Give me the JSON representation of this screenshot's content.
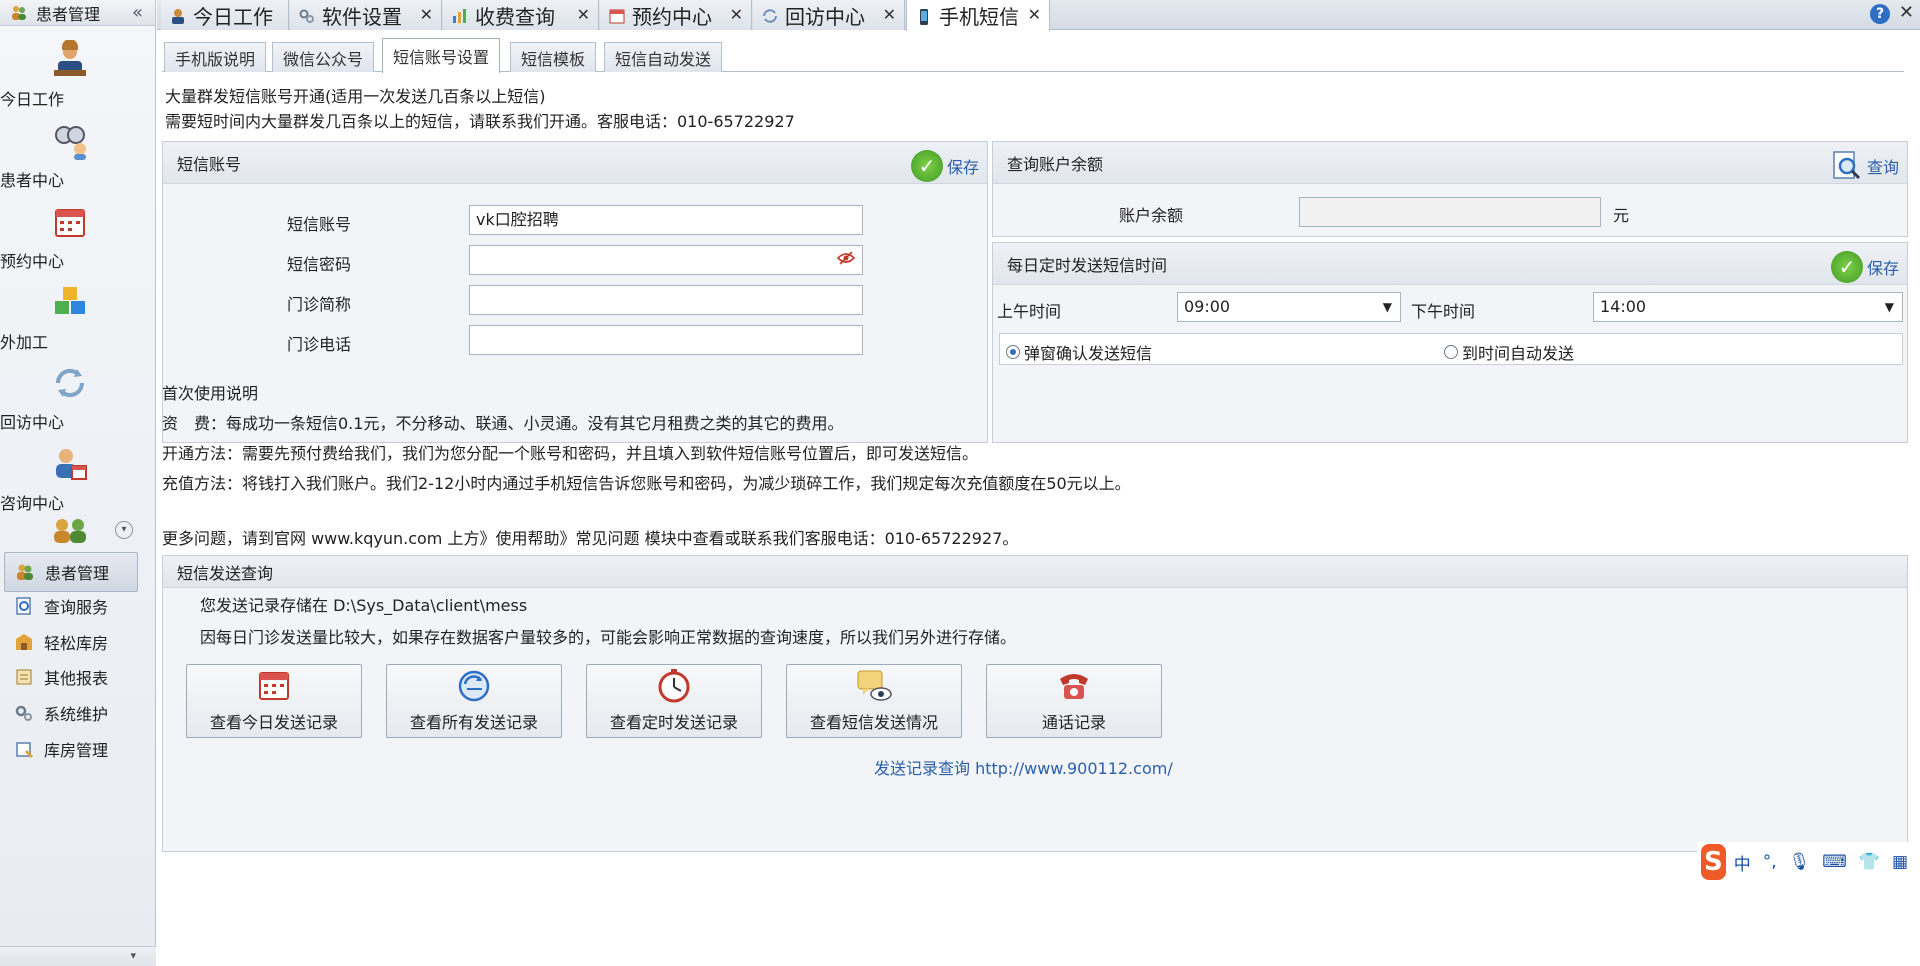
{
  "sidebar": {
    "header_title": "患者管理",
    "big_items": [
      {
        "label": "今日工作",
        "icon": "worker-icon"
      },
      {
        "label": "患者中心",
        "icon": "patients-icon"
      },
      {
        "label": "预约中心",
        "icon": "calendar-icon"
      },
      {
        "label": "外加工",
        "icon": "cubes-icon"
      },
      {
        "label": "回访中心",
        "icon": "refresh-icon"
      },
      {
        "label": "咨询中心",
        "icon": "consult-icon"
      }
    ],
    "small_items": [
      {
        "label": "患者管理",
        "icon": "patients-small-icon",
        "active": true
      },
      {
        "label": "查询服务",
        "icon": "query-icon",
        "active": false
      },
      {
        "label": "轻松库房",
        "icon": "warehouse-icon",
        "active": false
      },
      {
        "label": "其他报表",
        "icon": "report-icon",
        "active": false
      },
      {
        "label": "系统维护",
        "icon": "gears-icon",
        "active": false
      },
      {
        "label": "库房管理",
        "icon": "store-icon",
        "active": false
      }
    ]
  },
  "tabs": [
    {
      "label": "今日工作",
      "active": false
    },
    {
      "label": "软件设置",
      "active": false
    },
    {
      "label": "收费查询",
      "active": false
    },
    {
      "label": "预约中心",
      "active": false
    },
    {
      "label": "回访中心",
      "active": false
    },
    {
      "label": "手机短信",
      "active": true
    }
  ],
  "subtabs": [
    {
      "label": "手机版说明",
      "active": false
    },
    {
      "label": "微信公众号",
      "active": false
    },
    {
      "label": "短信账号设置",
      "active": true
    },
    {
      "label": "短信模板",
      "active": false
    },
    {
      "label": "短信自动发送",
      "active": false
    }
  ],
  "intro": {
    "line1": "大量群发短信账号开通(适用一次发送几百条以上短信)",
    "line2": "需要短时间内大量群发几百条以上的短信，请联系我们开通。客服电话：010-65722927"
  },
  "account_panel": {
    "title": "短信账号",
    "save_label": "保存",
    "fields": {
      "account_label": "短信账号",
      "account_value": "vk口腔招聘",
      "password_label": "短信密码",
      "password_value": "",
      "clinic_name_label": "门诊简称",
      "clinic_name_value": "",
      "clinic_phone_label": "门诊电话",
      "clinic_phone_value": ""
    }
  },
  "balance_panel": {
    "title": "查询账户余额",
    "query_label": "查询",
    "balance_label": "账户余额",
    "balance_value": "",
    "unit": "元"
  },
  "schedule_panel": {
    "title": "每日定时发送短信时间",
    "save_label": "保存",
    "am_label": "上午时间",
    "am_value": "09:00",
    "pm_label": "下午时间",
    "pm_value": "14:00",
    "radio_confirm": "弹窗确认发送短信",
    "radio_auto": "到时间自动发送",
    "selected": "confirm"
  },
  "instructions": {
    "title": "首次使用说明",
    "fee": "资　费：每成功一条短信0.1元，不分移动、联通、小灵通。没有其它月租费之类的其它的费用。",
    "open": "开通方法：需要先预付费给我们，我们为您分配一个账号和密码，并且填入到软件短信账号位置后，即可发送短信。",
    "recharge": "充值方法：将钱打入我们账户。我们2-12小时内通过手机短信告诉您账号和密码，为减少琐碎工作，我们规定每次充值额度在50元以上。",
    "more": "更多问题，请到官网 www.kqyun.com 上方》使用帮助》常见问题 模块中查看或联系我们客服电话：010-65722927。"
  },
  "query_panel": {
    "title": "短信发送查询",
    "storage_line": "您发送记录存储在 D:\\Sys_Data\\client\\mess",
    "note_line": "因每日门诊发送量比较大，如果存在数据客户量较多的，可能会影响正常数据的查询速度，所以我们另外进行存储。",
    "buttons": [
      {
        "label": "查看今日发送记录",
        "icon": "calendar-icon"
      },
      {
        "label": "查看所有发送记录",
        "icon": "refresh-globe-icon"
      },
      {
        "label": "查看定时发送记录",
        "icon": "clock-icon"
      },
      {
        "label": "查看短信发送情况",
        "icon": "message-eye-icon"
      },
      {
        "label": "通话记录",
        "icon": "phone-icon"
      }
    ],
    "link_label": "发送记录查询 http://www.900112.com/"
  },
  "ime": {
    "mode": "中",
    "punct": "°,"
  }
}
